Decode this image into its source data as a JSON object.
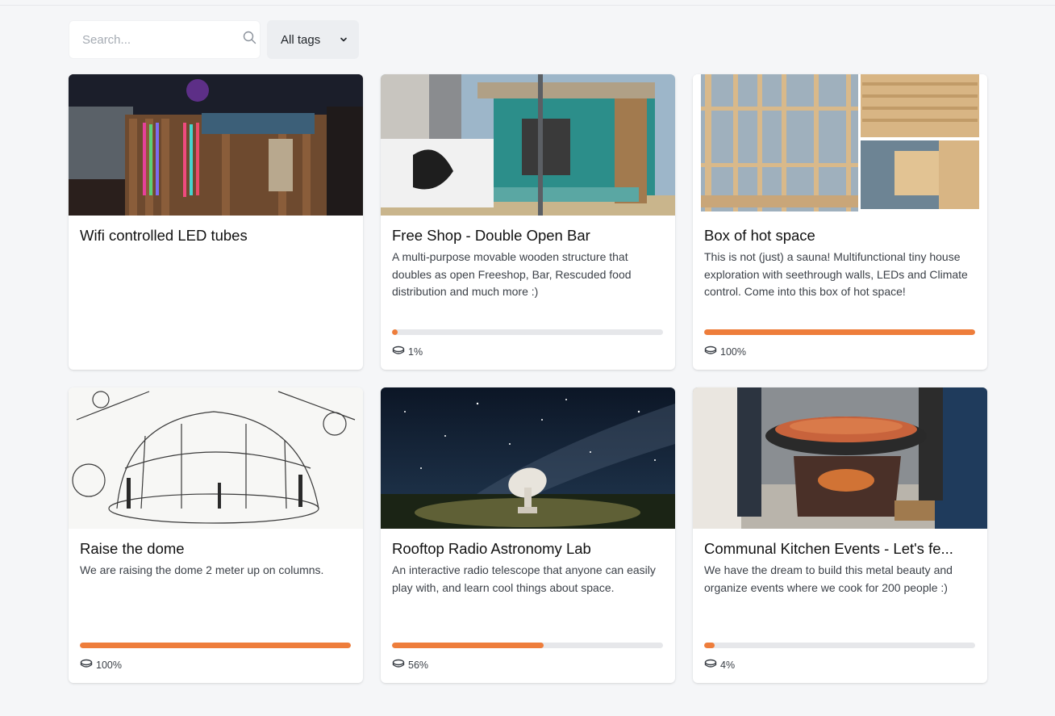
{
  "search": {
    "placeholder": "Search...",
    "value": ""
  },
  "tag_filter": {
    "selected": "All tags"
  },
  "colors": {
    "accent": "#ee7d3b",
    "track": "#e6e7ea",
    "background": "#f5f6f8"
  },
  "cards": [
    {
      "title": "Wifi controlled LED tubes",
      "description": "",
      "progress": null,
      "progress_label": ""
    },
    {
      "title": "Free Shop - Double Open Bar",
      "description": "A multi-purpose movable wooden structure that doubles as open Freeshop, Bar, Rescuded food distribution and much more :)",
      "progress": 1,
      "progress_label": "1%"
    },
    {
      "title": "Box of hot space",
      "description": "This is not (just) a sauna! Multifunctional tiny house exploration with seethrough walls, LEDs and Climate control. Come into this box of hot space!",
      "progress": 100,
      "progress_label": "100%"
    },
    {
      "title": "Raise the dome",
      "description": "We are raising the dome 2 meter up on columns.",
      "progress": 100,
      "progress_label": "100%"
    },
    {
      "title": "Rooftop Radio Astronomy Lab",
      "description": "An interactive radio telescope that anyone can easily play with, and learn cool things about space.",
      "progress": 56,
      "progress_label": "56%"
    },
    {
      "title": "Communal Kitchen Events - Let's fe...",
      "description": "We have the dream to build this metal beauty and organize events where we cook for 200 people :)",
      "progress": 4,
      "progress_label": "4%"
    }
  ]
}
